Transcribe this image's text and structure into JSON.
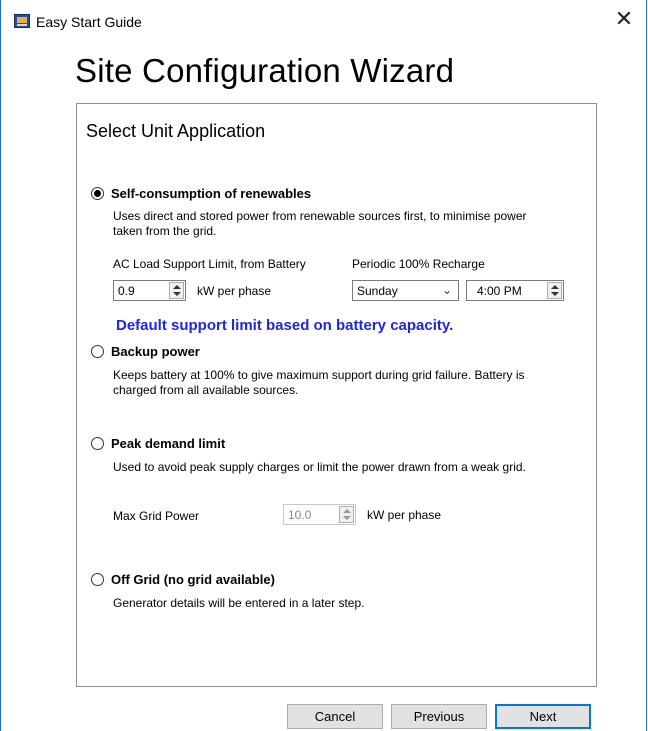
{
  "window": {
    "title": "Easy Start Guide",
    "close_icon": "close-icon"
  },
  "heading": "Site Configuration Wizard",
  "panel": {
    "title": "Select Unit Application"
  },
  "options": {
    "self_consumption": {
      "label": "Self-consumption of renewables",
      "checked": true,
      "description": "Uses direct and stored power from renewable sources first, to minimise power taken from the grid.",
      "ac_load_label": "AC Load Support Limit, from Battery",
      "ac_load_value": "0.9",
      "ac_load_unit": "kW per phase",
      "recharge_label": "Periodic 100% Recharge",
      "recharge_day": "Sunday",
      "recharge_time": "4:00 PM"
    },
    "backup": {
      "label": "Backup power",
      "checked": false,
      "description": "Keeps battery at 100% to give maximum support during grid failure. Battery is charged from all available sources."
    },
    "peak": {
      "label": "Peak demand limit",
      "checked": false,
      "description": "Used to avoid peak supply charges or limit the power drawn from a weak grid.",
      "max_grid_label": "Max Grid Power",
      "max_grid_value": "10.0",
      "max_grid_unit": "kW per phase"
    },
    "off_grid": {
      "label": "Off Grid (no grid available)",
      "checked": false,
      "description": "Generator details will be entered in a later step."
    }
  },
  "info_message": "Default support limit based on battery capacity.",
  "buttons": {
    "cancel": "Cancel",
    "previous": "Previous",
    "next": "Next"
  },
  "colors": {
    "info_text": "#1f27d6",
    "window_border": "#1e6fc7",
    "default_button_border": "#0078d7"
  }
}
